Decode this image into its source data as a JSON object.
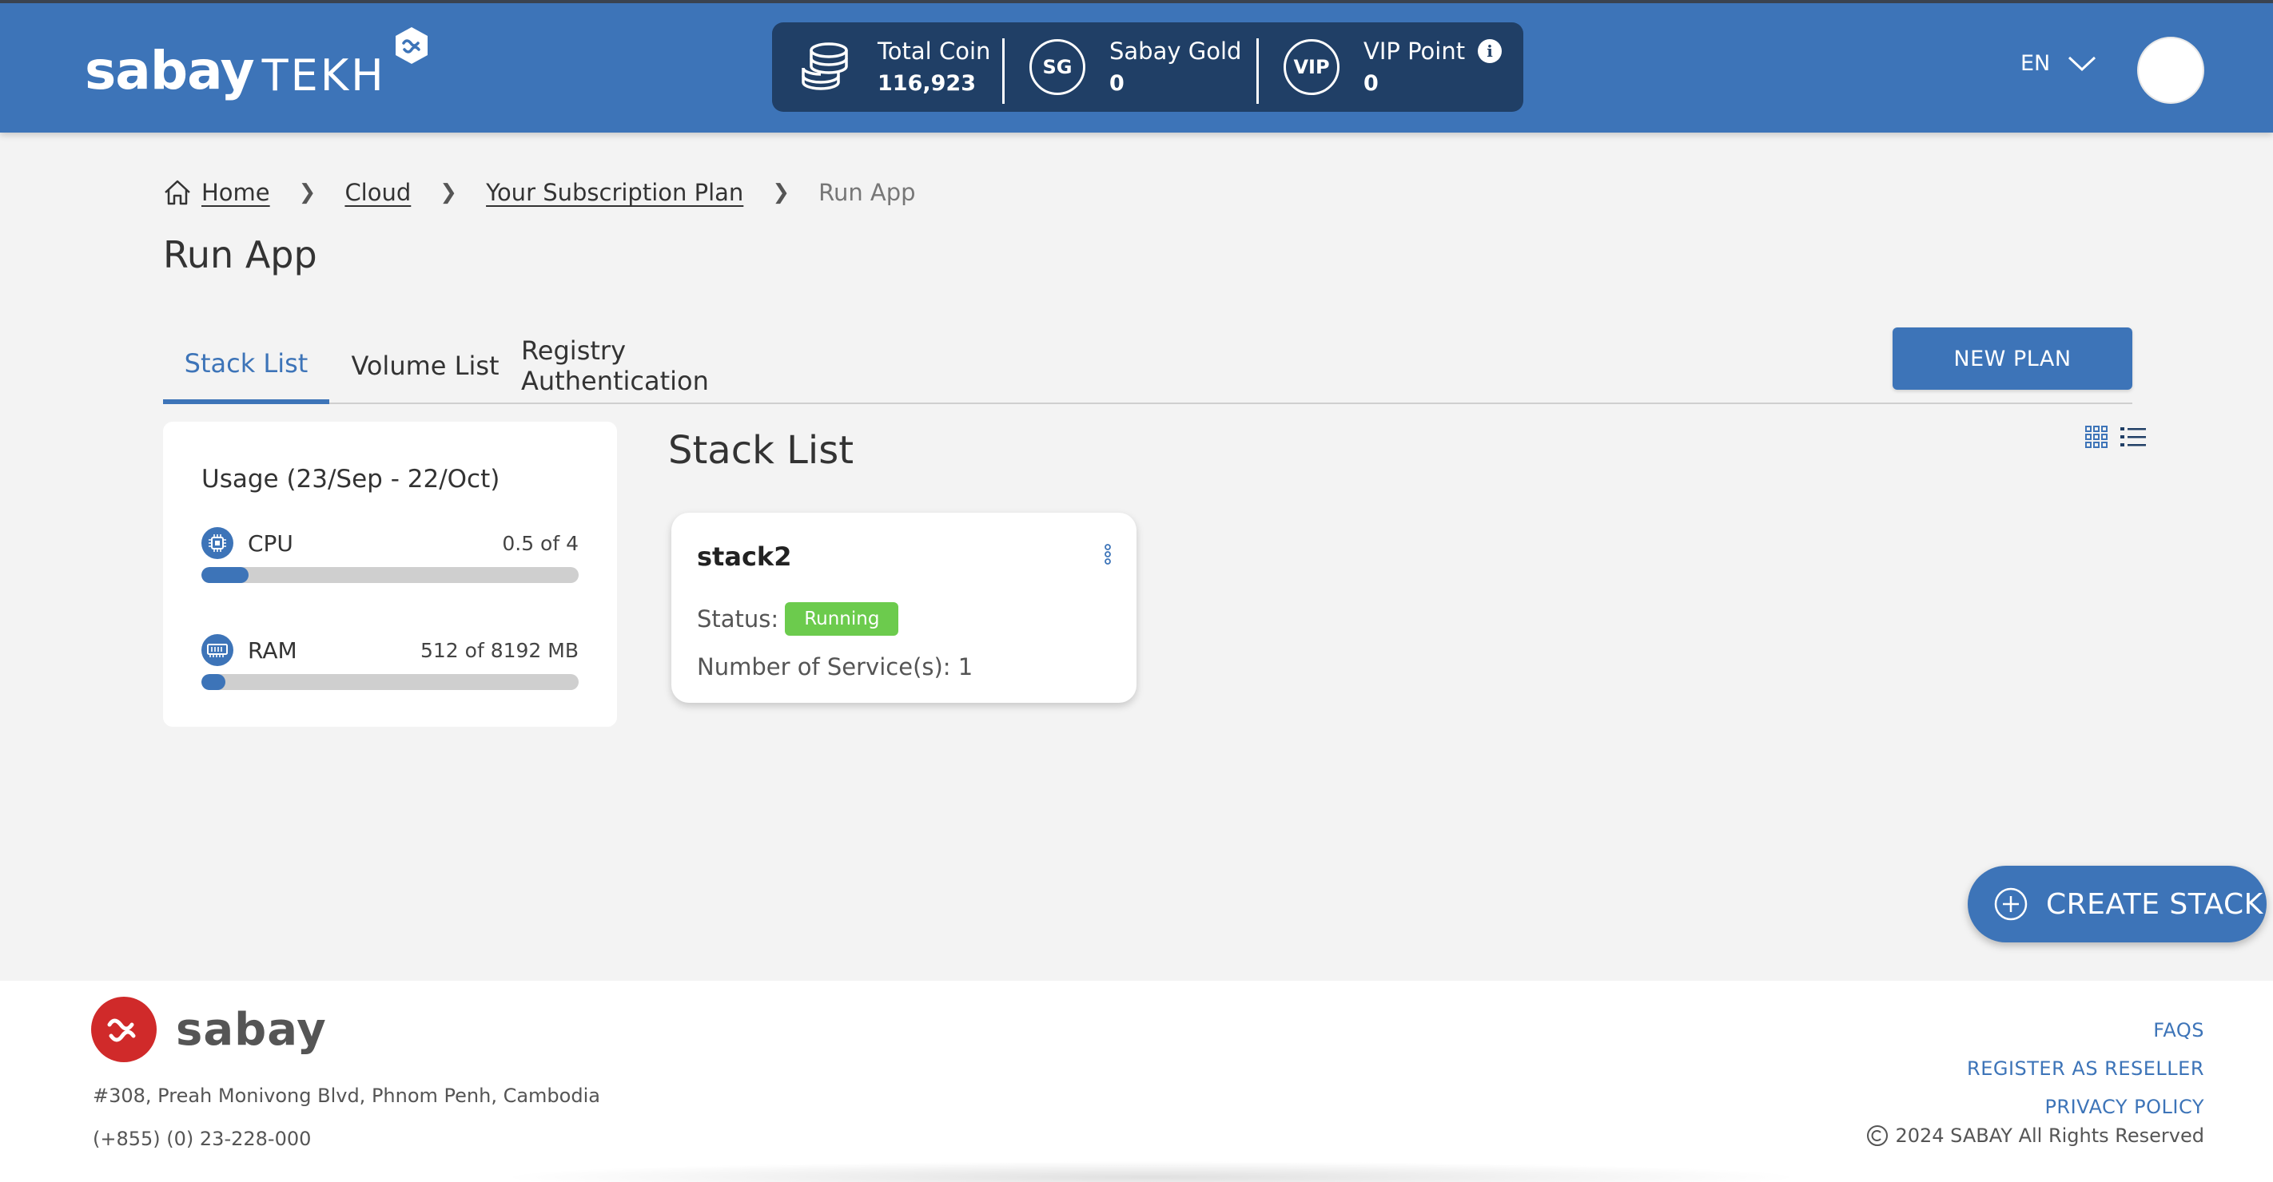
{
  "header": {
    "logo": {
      "primary": "sabay",
      "secondary": "TEKH"
    },
    "wallet": {
      "total_coin": {
        "label": "Total Coin",
        "value": "116,923"
      },
      "sabay_gold": {
        "label": "Sabay Gold",
        "value": "0",
        "icon_text": "SG"
      },
      "vip_point": {
        "label": "VIP Point",
        "value": "0",
        "icon_text": "VIP"
      }
    },
    "language": "EN"
  },
  "breadcrumb": {
    "home": "Home",
    "cloud": "Cloud",
    "plan": "Your Subscription Plan",
    "current": "Run App"
  },
  "page": {
    "title": "Run App"
  },
  "tabs": [
    {
      "label": "Stack List"
    },
    {
      "label": "Volume List"
    },
    {
      "label": "Registry Authentication"
    }
  ],
  "actions": {
    "new_plan": "NEW PLAN",
    "create_stack": "CREATE STACK"
  },
  "usage": {
    "title": "Usage (23/Sep - 22/Oct)",
    "cpu": {
      "label": "CPU",
      "value_text": "0.5 of 4",
      "fraction": 0.125
    },
    "ram": {
      "label": "RAM",
      "value_text": "512 of 8192 MB",
      "fraction": 0.0625
    }
  },
  "stacks": {
    "section_title": "Stack List",
    "items": [
      {
        "name": "stack2",
        "status_label": "Status:",
        "status": "Running",
        "services_text": "Number of Service(s): 1"
      }
    ]
  },
  "footer": {
    "logo_text": "sabay",
    "address": "#308, Preah Monivong Blvd, Phnom Penh, Cambodia",
    "phone": "(+855) (0) 23-228-000",
    "links": {
      "faqs": "FAQS",
      "reseller": "REGISTER AS RESELLER",
      "privacy": "PRIVACY POLICY"
    },
    "copyright": "2024  SABAY  All Rights Reserved"
  },
  "colors": {
    "primary": "#3d74b8",
    "header_dark": "#203f66",
    "status_running": "#6ccb4d",
    "brand_red": "#d02a2a"
  }
}
